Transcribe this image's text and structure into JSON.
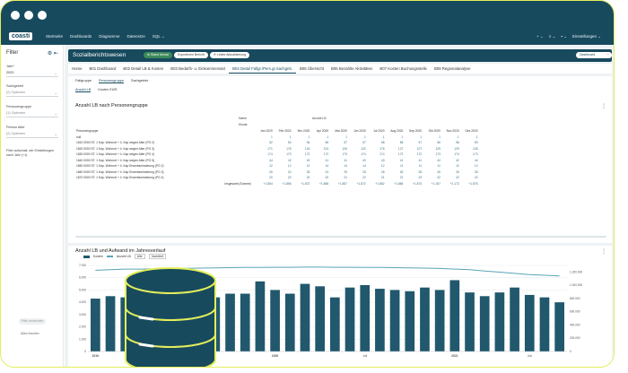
{
  "app": {
    "logo": "coasti",
    "nav": [
      "Startseite",
      "Dashboards",
      "Diagramme",
      "Datenstze",
      "SQL ⌄"
    ],
    "nav_right": [
      "+ ⌄",
      "≡ ⌄",
      "▪ ⌄",
      "Einstellungen ⌄"
    ]
  },
  "sidebar": {
    "title": "Filter",
    "filters": [
      {
        "label": "Jahr*",
        "value": "2020"
      },
      {
        "label": "Sachgebiet",
        "value": "(2) Optionen"
      },
      {
        "label": "Personengruppe",
        "value": "(1) Optionen"
      },
      {
        "label": "Person Alter",
        "value": "(2) Optionen"
      }
    ],
    "toggle_label": "Filter aufschalt. der Einstellungen nach Jahr (+1)",
    "apply": "Filter anwenden",
    "clear": "Alles löschen"
  },
  "header": {
    "title": "Sozialberichtswesen",
    "pills": [
      "⊕ Stand Monat",
      "Exportieren Bericht",
      "⟳ Letzte Aktualisierung"
    ],
    "right_pill": "Dashboard bearbeiten"
  },
  "tabs": [
    "Home",
    "B01 Dashboard",
    "B02 Detail LB & Kosten",
    "B03 Bedarfs- u. Einkommensart",
    "B04 Detail Fallgr./Pers.gr.Sachgeb.",
    "B05 Übersicht",
    "B06 Bezahlte Aktivitäten",
    "B07 Kosten Buchungsstelle",
    "B08 Regionalanalyse"
  ],
  "active_tab": 4,
  "subtabs": [
    "Fallgruppe",
    "Personengruppe",
    "Sachgebiet"
  ],
  "subtabs2": [
    "Anzahl LB",
    "Kosten EUR"
  ],
  "table_card": {
    "title": "Anzahl LB nach Personengruppe",
    "top_labels": [
      "Name",
      "Monat"
    ],
    "name_value": "Anzahl LB",
    "row_header": "Personengruppe",
    "months": [
      "Jan 2020",
      "Feb 2020",
      "Mrz 2020",
      "Apr 2020",
      "Mai 2020",
      "Jun 2020",
      "Jul 2020",
      "Aug 2020",
      "Sep 2020",
      "Okt 2020",
      "Nov 2020",
      "Dez 2020"
    ],
    "rows": [
      {
        "label": "null",
        "values": [
          "1",
          "1",
          "1",
          "1",
          "1",
          "1",
          "1",
          "1",
          "1",
          "1",
          "1",
          "1"
        ]
      },
      {
        "label": "1610 0000 ST. 1 Kap. Wohnort + 4. Kap wegen Alter (PG 2)",
        "values": [
          "52",
          "50",
          "54",
          "56",
          "57",
          "57",
          "58",
          "58",
          "57",
          "56",
          "58",
          "59"
        ]
      },
      {
        "label": "1620 0000 ST. 1 Kap. Wohnort + 4. Kap wegen Alter (PG 3)",
        "values": [
          "171",
          "176",
          "124",
          "124",
          "126",
          "122",
          "176",
          "127",
          "127",
          "129",
          "129",
          "128"
        ]
      },
      {
        "label": "1630 0000 ST. 1 Kap. Wohnort + 4. Kap wegen Alter (PG 4)",
        "values": [
          "174",
          "173",
          "172",
          "172",
          "173",
          "174",
          "174",
          "172",
          "172",
          "173",
          "174",
          "173"
        ]
      },
      {
        "label": "1640 0000 ST. 1 Kap. Wohnort + 4. Kap wegen Alter (PG 5)",
        "values": [
          "44",
          "42",
          "43",
          "41",
          "41",
          "40",
          "43",
          "41",
          "41",
          "42",
          "42",
          "44"
        ]
      },
      {
        "label": "1650 0000 ST. 1 Kap. Wohnort + 4. Kap Erwerbsminderung (PG 2)",
        "values": [
          "12",
          "12",
          "12",
          "14",
          "14",
          "14",
          "12",
          "11",
          "11",
          "11",
          "12",
          "12"
        ]
      },
      {
        "label": "1660 0000 ST. 1 Kap. Wohnort + 4. Kap Erwerbsminderung (PG 3)",
        "values": [
          "26",
          "24",
          "25",
          "24",
          "25",
          "25",
          "26",
          "26",
          "28",
          "26",
          "26",
          "26"
        ]
      },
      {
        "label": "1670 0000 ST. 1 Kap. Wohnort + 4. Kap Erwerbsminderung (PG 4)",
        "values": [
          "20",
          "20",
          "20",
          "20",
          "21",
          "22",
          "21",
          "21",
          "22",
          "22",
          "22",
          "22"
        ]
      }
    ],
    "total_label": "Insgesamt (Summe)",
    "totals": [
      "+1.854",
      "+1.856",
      "+1.872",
      "+1.868",
      "+1.857",
      "+1.872",
      "+1.862",
      "+1.866",
      "+1.874",
      "+1.167",
      "+1.172",
      "+1.876"
    ]
  },
  "chart_card": {
    "title": "Anzahl LB und Aufwand im Jahresverlauf",
    "legend": [
      "Kosten",
      "Anzahl LB",
      "Alle",
      "Invertiert"
    ]
  },
  "chart_data": {
    "type": "bar",
    "title": "Anzahl LB und Aufwand im Jahresverlauf",
    "left_ticks": [
      "0",
      "1.000",
      "2.000",
      "3.000",
      "4.000",
      "5.000",
      "6.000",
      "7.000"
    ],
    "right_ticks": [
      "0",
      "200.000",
      "400.000",
      "600.000",
      "800.000",
      "1.000.000",
      "1.200.000"
    ],
    "ylim": [
      0,
      7000
    ],
    "y2lim": [
      0,
      1300000
    ],
    "x_labels": [
      "2019",
      "Juli",
      "2020",
      "Juli",
      "2021",
      "Juli"
    ],
    "series": [
      {
        "name": "Kosten",
        "values": [
          4300,
          4500,
          4400,
          4500,
          4600,
          4300,
          4000,
          5100,
          4400,
          4700,
          4700,
          5700,
          5000,
          4700,
          5500,
          5300,
          4400,
          5200,
          5400,
          5100,
          5000,
          4900,
          5200,
          5000,
          5800,
          4800,
          4500,
          4800,
          5200,
          4600,
          4400,
          4000
        ]
      },
      {
        "name": "Anzahl LB",
        "values": [
          6600,
          6650,
          6700,
          6700,
          6720,
          6750,
          6760,
          6780,
          6800,
          6820,
          6830,
          6840,
          6850,
          6850,
          6860,
          6860,
          6850,
          6850,
          6840,
          6830,
          6820,
          6800,
          6780,
          6750,
          6700,
          6650,
          6550,
          6450,
          6350,
          6250,
          6200,
          6150
        ]
      }
    ],
    "x_label_positions": [
      0,
      6,
      12,
      18,
      24,
      29
    ]
  },
  "colors": {
    "brand": "#184a5e",
    "bar": "#21586d",
    "line": "#5ba4b8",
    "accent": "#e2ee5a"
  },
  "icons": [
    "gear-icon",
    "collapse-icon",
    "database-icon",
    "more-icon"
  ]
}
